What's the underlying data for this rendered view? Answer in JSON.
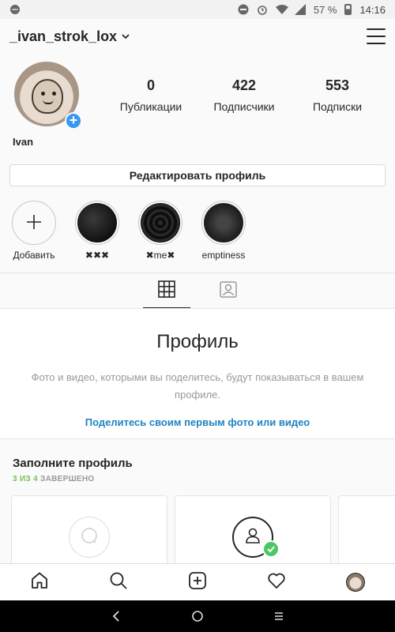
{
  "statusbar": {
    "battery": "57 %",
    "time": "14:16"
  },
  "header": {
    "username": "_ivan_strok_lox"
  },
  "profile": {
    "display_name": "Ivan",
    "stats": [
      {
        "value": "0",
        "label": "Публикации"
      },
      {
        "value": "422",
        "label": "Подписчики"
      },
      {
        "value": "553",
        "label": "Подписки"
      }
    ],
    "edit_label": "Редактировать профиль"
  },
  "highlights": [
    {
      "label": "Добавить",
      "type": "add"
    },
    {
      "label": "✖✖✖",
      "type": "story"
    },
    {
      "label": "✖me✖",
      "type": "story"
    },
    {
      "label": "emptiness",
      "type": "story"
    }
  ],
  "empty_state": {
    "title": "Профиль",
    "text": "Фото и видео, которыми вы поделитесь, будут показываться в вашем профиле.",
    "link": "Поделитесь своим первым фото или видео"
  },
  "complete_profile": {
    "title": "Заполните профиль",
    "done": "3 ИЗ 4",
    "rest": " ЗАВЕРШЕНО"
  },
  "colors": {
    "accent": "#3897f0",
    "link": "#1d83c4",
    "success": "#4cc763",
    "progress_done": "#78c257"
  }
}
